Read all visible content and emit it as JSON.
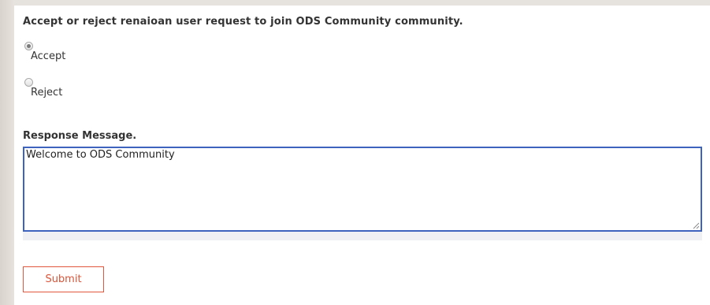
{
  "form": {
    "heading": "Accept or reject renaioan user request to join ODS Community community.",
    "options": [
      {
        "label": "Accept",
        "checked": true
      },
      {
        "label": "Reject",
        "checked": false
      }
    ],
    "message_label": "Response Message.",
    "message_value": "Welcome to ODS Community",
    "submit_label": "Submit"
  },
  "colors": {
    "text": "#333333",
    "focus_border": "#3d63bf",
    "submit_accent": "#e0573e",
    "page_bg": "#e6e2de"
  },
  "icons": [
    "radio-checked-icon",
    "radio-unchecked-icon",
    "resize-grip-icon"
  ]
}
